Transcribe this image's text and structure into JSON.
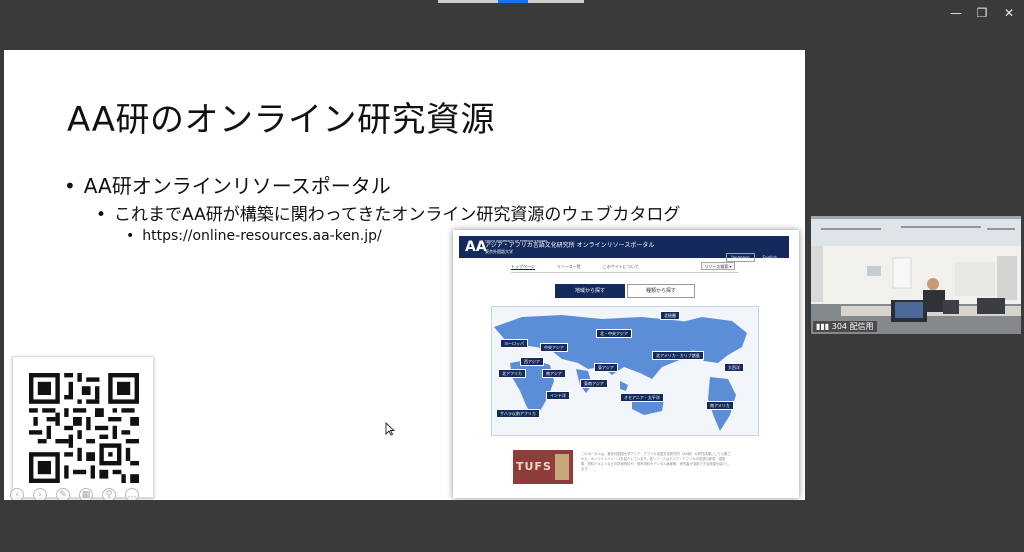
{
  "window": {
    "controls": {
      "minimize": "—",
      "restore": "❐",
      "close": "✕"
    }
  },
  "slide": {
    "title": "AA研のオンライン研究資源",
    "bullet1": "AA研オンラインリソースポータル",
    "bullet2": "これまでAA研が構築に関わってきたオンライン研究資源のウェブカタログ",
    "bullet3": "https://online-resources.aa-ken.jp/",
    "bullet_mark": "•"
  },
  "website": {
    "logo": "AA",
    "title_small": "TOKYO UNIVERSITY OF FOREIGN STUDIES",
    "title_main": "アジア・アフリカ言語文化研究所 オンラインリソースポータル",
    "title_sub": "東京外国語大学",
    "lang": [
      "Japanese",
      "English"
    ],
    "nav": [
      "トップページ",
      "リソース一覧",
      "このサイトについて"
    ],
    "select_label": "リソース検索 ▾",
    "map_tabs": [
      "地域から探す",
      "種類から探す"
    ],
    "regions": [
      "北極圏",
      "ヨーロッパ",
      "北・中央アジア",
      "中央アジア",
      "西アジア",
      "北アフリカ",
      "南アジア",
      "東アジア",
      "東南アジア",
      "北アメリカ・カリブ諸島",
      "大西洋",
      "インド洋",
      "オセアニア・太平洋",
      "南アメリカ",
      "サハラ以南アフリカ"
    ],
    "footer_image_text": "TUFS",
    "footer_text": "このポータルは、東京外国語大学アジア・アフリカ言語文化研究所（AA研）の研究成果として公開された、オンラインリソースを紹介しています。各リソースはアジア・アフリカの言語の辞書・語彙集・資料テキストなどの学術資料や、音声資料やデジタル画像等、研究者が活用できる資源を紹介します。"
  },
  "video": {
    "participant_label": "304 配信用"
  },
  "colors": {
    "site_navy": "#142a5c",
    "map_land": "#5b8ed6"
  }
}
